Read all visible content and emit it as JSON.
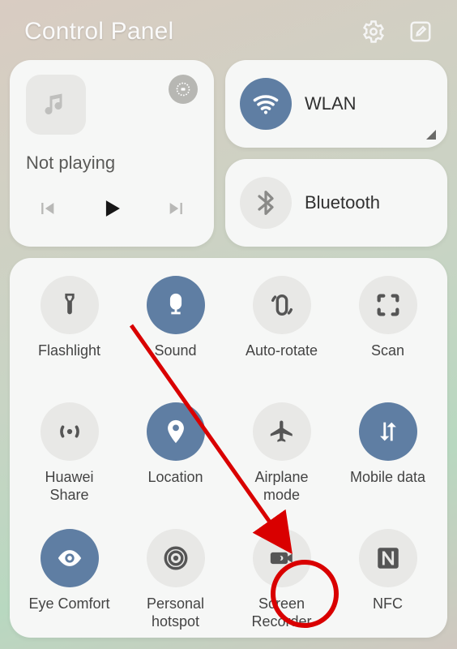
{
  "header": {
    "title": "Control Panel"
  },
  "media": {
    "status": "Not playing"
  },
  "wlan": {
    "label": "WLAN",
    "active": true
  },
  "bluetooth": {
    "label": "Bluetooth",
    "active": false
  },
  "colors": {
    "accent": "#5f7ea3",
    "inactive_bg": "#e8e8e6"
  },
  "toggles": [
    {
      "id": "flashlight",
      "label": "Flashlight",
      "active": false
    },
    {
      "id": "sound",
      "label": "Sound",
      "active": true
    },
    {
      "id": "autorotate",
      "label": "Auto-rotate",
      "active": false
    },
    {
      "id": "scan",
      "label": "Scan",
      "active": false
    },
    {
      "id": "huawei-share",
      "label": "Huawei\nShare",
      "active": false
    },
    {
      "id": "location",
      "label": "Location",
      "active": true
    },
    {
      "id": "airplane",
      "label": "Airplane\nmode",
      "active": false
    },
    {
      "id": "mobile-data",
      "label": "Mobile data",
      "active": true
    },
    {
      "id": "eye-comfort",
      "label": "Eye Comfort",
      "active": true
    },
    {
      "id": "hotspot",
      "label": "Personal\nhotspot",
      "active": false
    },
    {
      "id": "screen-rec",
      "label": "Screen\nRecorder",
      "active": false
    },
    {
      "id": "nfc",
      "label": "NFC",
      "active": false
    }
  ]
}
